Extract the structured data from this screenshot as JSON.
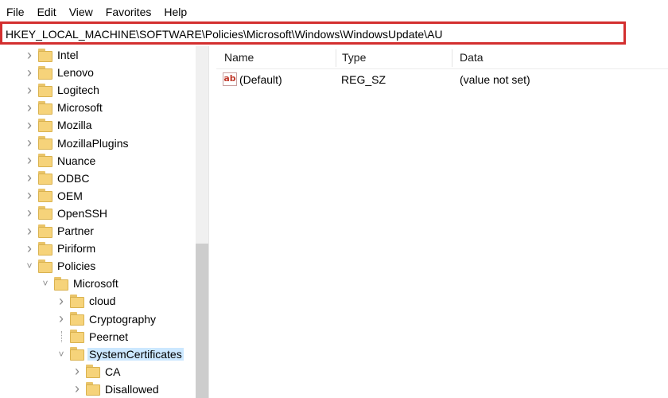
{
  "menu": [
    "File",
    "Edit",
    "View",
    "Favorites",
    "Help"
  ],
  "address": {
    "value": "HKEY_LOCAL_MACHINE\\SOFTWARE\\Policies\\Microsoft\\Windows\\WindowsUpdate\\AU",
    "highlight_color": "#d32f2f"
  },
  "tree": {
    "items": [
      {
        "label": "Intel",
        "depth": 0,
        "expanded": false
      },
      {
        "label": "Lenovo",
        "depth": 0,
        "expanded": false
      },
      {
        "label": "Logitech",
        "depth": 0,
        "expanded": false
      },
      {
        "label": "Microsoft",
        "depth": 0,
        "expanded": false
      },
      {
        "label": "Mozilla",
        "depth": 0,
        "expanded": false
      },
      {
        "label": "MozillaPlugins",
        "depth": 0,
        "expanded": false
      },
      {
        "label": "Nuance",
        "depth": 0,
        "expanded": false
      },
      {
        "label": "ODBC",
        "depth": 0,
        "expanded": false
      },
      {
        "label": "OEM",
        "depth": 0,
        "expanded": false
      },
      {
        "label": "OpenSSH",
        "depth": 0,
        "expanded": false
      },
      {
        "label": "Partner",
        "depth": 0,
        "expanded": false
      },
      {
        "label": "Piriform",
        "depth": 0,
        "expanded": false
      },
      {
        "label": "Policies",
        "depth": 0,
        "expanded": true
      },
      {
        "label": "Microsoft",
        "depth": 1,
        "expanded": true
      },
      {
        "label": "cloud",
        "depth": 2,
        "expanded": false
      },
      {
        "label": "Cryptography",
        "depth": 2,
        "expanded": false
      },
      {
        "label": "Peernet",
        "depth": 2,
        "expanded": null
      },
      {
        "label": "SystemCertificates",
        "depth": 2,
        "expanded": true,
        "selected": true
      },
      {
        "label": "CA",
        "depth": 3,
        "expanded": false
      },
      {
        "label": "Disallowed",
        "depth": 3,
        "expanded": false
      }
    ],
    "selected_bg": "#cce8ff",
    "folder_color": "#f6d37a"
  },
  "list": {
    "columns": [
      "Name",
      "Type",
      "Data"
    ],
    "rows": [
      {
        "icon": "string-value-icon",
        "icon_text": "ab",
        "name": "(Default)",
        "type": "REG_SZ",
        "data": "(value not set)"
      }
    ]
  }
}
